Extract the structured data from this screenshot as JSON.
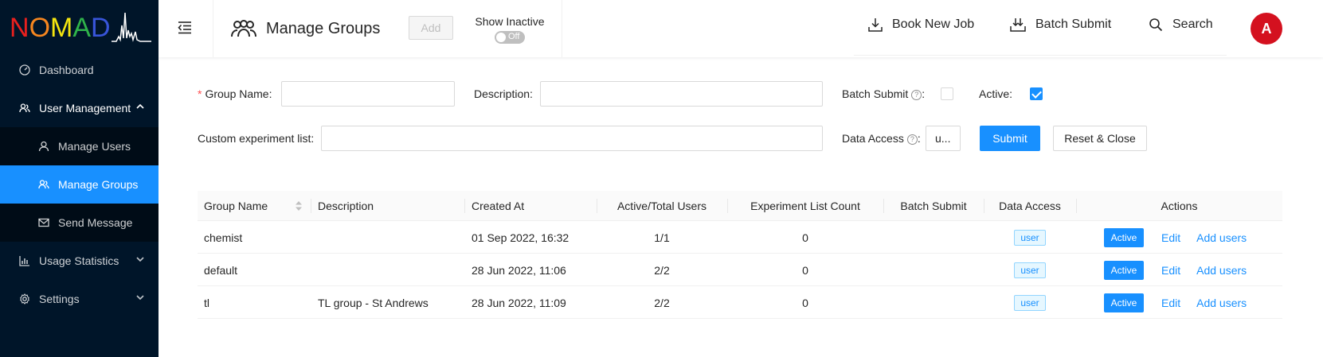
{
  "logo": {
    "letters": [
      {
        "ch": "N",
        "color": "#e8201e"
      },
      {
        "ch": "O",
        "color": "#f6861f"
      },
      {
        "ch": "M",
        "color": "#f3e50f"
      },
      {
        "ch": "A",
        "color": "#2fb34a"
      },
      {
        "ch": "D",
        "color": "#3855d9"
      }
    ]
  },
  "sidebar": {
    "items": [
      {
        "label": "Dashboard",
        "icon": "dashboard-icon"
      },
      {
        "label": "User Management",
        "icon": "team-icon"
      },
      {
        "label": "Manage Users",
        "icon": "user-icon"
      },
      {
        "label": "Manage Groups",
        "icon": "team-icon"
      },
      {
        "label": "Send Message",
        "icon": "mail-icon"
      },
      {
        "label": "Usage Statistics",
        "icon": "bar-chart-icon"
      },
      {
        "label": "Settings",
        "icon": "gear-icon"
      }
    ]
  },
  "header": {
    "title": "Manage Groups",
    "add_label": "Add",
    "show_inactive_label": "Show Inactive",
    "toggle_text": "Off",
    "book_new_job": "Book New Job",
    "batch_submit": "Batch Submit",
    "search": "Search",
    "avatar_initial": "A"
  },
  "form": {
    "group_name_label": "Group Name",
    "group_name_value": "",
    "description_label": "Description",
    "description_value": "",
    "batch_submit_label": "Batch Submit",
    "batch_submit_checked": false,
    "active_label": "Active",
    "active_checked": true,
    "custom_list_label": "Custom experiment list",
    "custom_list_value": "",
    "data_access_label": "Data Access",
    "data_access_value": "u...",
    "submit_label": "Submit",
    "reset_label": "Reset & Close"
  },
  "table": {
    "columns": [
      "Group Name",
      "Description",
      "Created At",
      "Active/Total Users",
      "Experiment List Count",
      "Batch Submit",
      "Data Access",
      "Actions"
    ],
    "rows": [
      {
        "name": "chemist",
        "description": "",
        "created": "01 Sep 2022, 16:32",
        "users": "1/1",
        "exp_count": "0",
        "batch": "",
        "access": "user",
        "status": "Active",
        "edit": "Edit",
        "add_users": "Add users"
      },
      {
        "name": "default",
        "description": "",
        "created": "28 Jun 2022, 11:06",
        "users": "2/2",
        "exp_count": "0",
        "batch": "",
        "access": "user",
        "status": "Active",
        "edit": "Edit",
        "add_users": "Add users"
      },
      {
        "name": "tl",
        "description": "TL group - St Andrews",
        "created": "28 Jun 2022, 11:09",
        "users": "2/2",
        "exp_count": "0",
        "batch": "",
        "access": "user",
        "status": "Active",
        "edit": "Edit",
        "add_users": "Add users"
      }
    ]
  }
}
